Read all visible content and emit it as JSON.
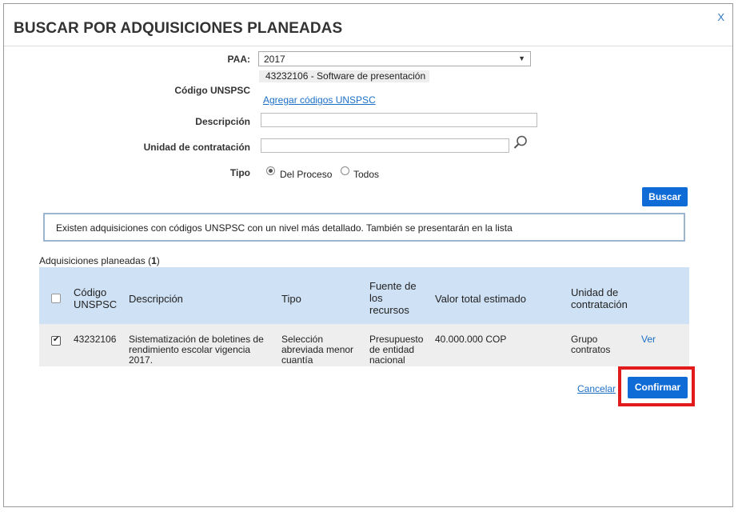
{
  "dialog": {
    "title": "BUSCAR POR ADQUISICIONES PLANEADAS",
    "close_label": "X"
  },
  "form": {
    "paa_label": "PAA:",
    "paa_value": "2017",
    "unspsc_label": "Código UNSPSC",
    "unspsc_chip": "43232106 - Software de presentación",
    "unspsc_add_link": "Agregar códigos UNSPSC",
    "descripcion_label": "Descripción",
    "descripcion_value": "",
    "unidad_label": "Unidad de contratación",
    "unidad_value": "",
    "tipo_label": "Tipo",
    "tipo_options": [
      "Del Proceso",
      "Todos"
    ],
    "tipo_selected": "Del Proceso",
    "search_button": "Buscar"
  },
  "info_message": "Existen adquisiciones con códigos UNSPSC con un nivel más detallado. También se presentarán en la lista",
  "results": {
    "label": "Adquisiciones planeadas",
    "count_open": "(",
    "count": "1",
    "count_close": ")",
    "columns": {
      "codigo": [
        "Código",
        "UNSPSC"
      ],
      "descripcion": "Descripción",
      "tipo": "Tipo",
      "fuente": [
        "Fuente de",
        "los",
        "recursos"
      ],
      "valor": "Valor total estimado",
      "unidad": [
        "Unidad de",
        "contratación"
      ]
    },
    "rows": [
      {
        "checked": true,
        "codigo": "43232106",
        "descripcion": [
          "Sistematización de boletines de",
          "rendimiento escolar vigencia",
          "2017."
        ],
        "tipo": [
          "Selección",
          "abreviada menor",
          "cuantía"
        ],
        "fuente": [
          "Presupuesto",
          "de entidad",
          "nacional"
        ],
        "valor": "40.000.000 COP",
        "unidad": [
          "Grupo",
          "contratos"
        ],
        "action": "Ver"
      }
    ]
  },
  "footer": {
    "cancel_label": "Cancelar",
    "confirm_label": "Confirmar"
  },
  "colors": {
    "primary_button": "#0f6cd6",
    "table_header": "#cfe1f4",
    "highlight_box": "#e11b1b"
  }
}
